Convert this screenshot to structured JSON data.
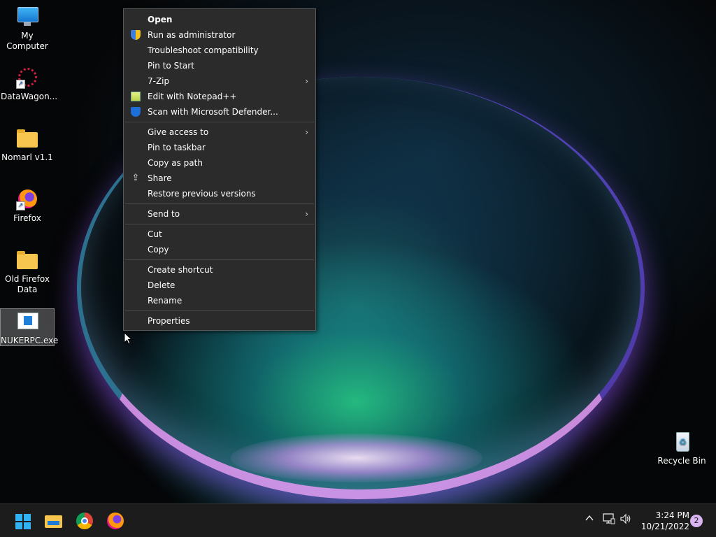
{
  "desktop": {
    "icons": [
      {
        "label": "My Computer",
        "icon": "monitor-icon"
      },
      {
        "label": "DataWagon...",
        "icon": "datawagon-icon"
      },
      {
        "label": "Nomarl v1.1",
        "icon": "folder-icon"
      },
      {
        "label": "Firefox",
        "icon": "firefox-icon"
      },
      {
        "label": "Old Firefox Data",
        "icon": "folder-icon"
      },
      {
        "label": "NUKERPC.exe",
        "icon": "exe-icon",
        "selected": true
      },
      {
        "label": "Recycle Bin",
        "icon": "recycle-bin-icon"
      }
    ]
  },
  "context_menu": {
    "groups": [
      [
        {
          "label": "Open",
          "bold": true
        },
        {
          "label": "Run as administrator",
          "icon": "uac-shield-icon"
        },
        {
          "label": "Troubleshoot compatibility"
        },
        {
          "label": "Pin to Start"
        },
        {
          "label": "7-Zip",
          "submenu": true
        },
        {
          "label": "Edit with Notepad++",
          "icon": "notepad-plus-plus-icon"
        },
        {
          "label": "Scan with Microsoft Defender...",
          "icon": "defender-icon"
        }
      ],
      [
        {
          "label": "Give access to",
          "submenu": true
        },
        {
          "label": "Pin to taskbar"
        },
        {
          "label": "Copy as path"
        },
        {
          "label": "Share",
          "icon": "share-icon"
        },
        {
          "label": "Restore previous versions"
        }
      ],
      [
        {
          "label": "Send to",
          "submenu": true
        }
      ],
      [
        {
          "label": "Cut"
        },
        {
          "label": "Copy"
        }
      ],
      [
        {
          "label": "Create shortcut"
        },
        {
          "label": "Delete"
        },
        {
          "label": "Rename"
        }
      ],
      [
        {
          "label": "Properties"
        }
      ]
    ],
    "submenu_glyph": "›"
  },
  "taskbar": {
    "apps": [
      "start-icon",
      "file-explorer-icon",
      "chrome-icon",
      "firefox-icon"
    ],
    "tray": {
      "overflow_glyph": "^",
      "network_glyph": "🖧",
      "volume_glyph": "🔊",
      "time": "3:24 PM",
      "date": "10/21/2022",
      "notification_count": "2"
    }
  },
  "colors": {
    "menu_bg": "#2b2b2b",
    "taskbar_bg": "#1c1c1c",
    "start_blue": "#31b2f5",
    "badge": "#d8b4f0"
  }
}
